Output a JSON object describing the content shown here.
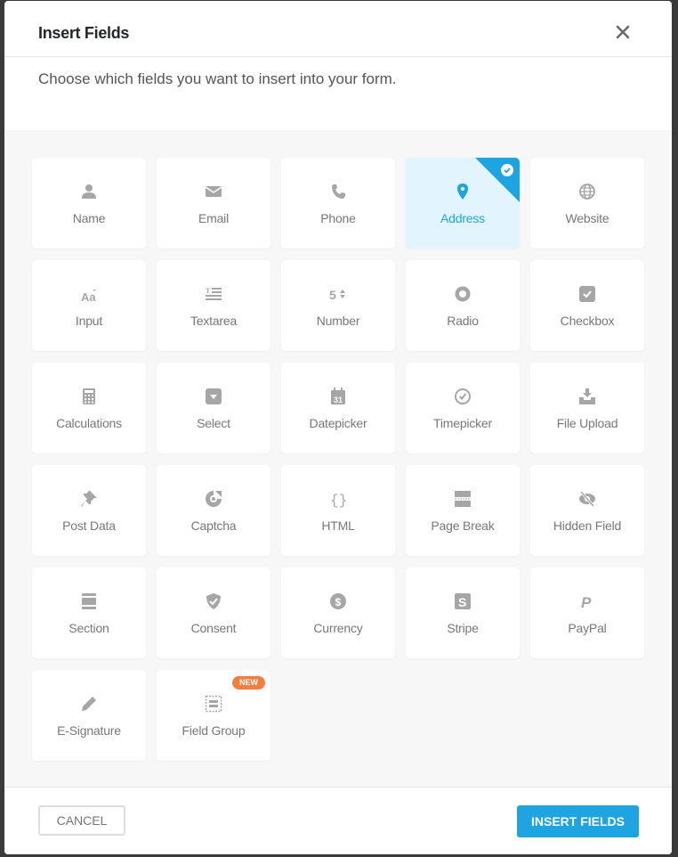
{
  "dialog": {
    "title": "Insert Fields",
    "subtitle": "Choose which fields you want to insert into your form.",
    "close_icon": "close-icon"
  },
  "colors": {
    "accent": "#1ea4e0",
    "selected_bg": "#e2f5fe",
    "badge": "#f47d3f",
    "icon": "#a6a6a6"
  },
  "fields": [
    {
      "label": "Name",
      "icon": "user-icon",
      "selected": false
    },
    {
      "label": "Email",
      "icon": "envelope-icon",
      "selected": false
    },
    {
      "label": "Phone",
      "icon": "phone-icon",
      "selected": false
    },
    {
      "label": "Address",
      "icon": "map-pin-icon",
      "selected": true
    },
    {
      "label": "Website",
      "icon": "globe-icon",
      "selected": false
    },
    {
      "label": "Input",
      "icon": "text-input-icon",
      "selected": false
    },
    {
      "label": "Textarea",
      "icon": "textarea-icon",
      "selected": false
    },
    {
      "label": "Number",
      "icon": "number-icon",
      "selected": false
    },
    {
      "label": "Radio",
      "icon": "radio-icon",
      "selected": false
    },
    {
      "label": "Checkbox",
      "icon": "checkbox-icon",
      "selected": false
    },
    {
      "label": "Calculations",
      "icon": "calculator-icon",
      "selected": false
    },
    {
      "label": "Select",
      "icon": "select-icon",
      "selected": false
    },
    {
      "label": "Datepicker",
      "icon": "calendar-icon",
      "selected": false
    },
    {
      "label": "Timepicker",
      "icon": "clock-icon",
      "selected": false
    },
    {
      "label": "File Upload",
      "icon": "upload-icon",
      "selected": false
    },
    {
      "label": "Post Data",
      "icon": "pin-icon",
      "selected": false
    },
    {
      "label": "Captcha",
      "icon": "captcha-icon",
      "selected": false
    },
    {
      "label": "HTML",
      "icon": "braces-icon",
      "selected": false
    },
    {
      "label": "Page Break",
      "icon": "page-break-icon",
      "selected": false
    },
    {
      "label": "Hidden Field",
      "icon": "eye-slash-icon",
      "selected": false
    },
    {
      "label": "Section",
      "icon": "section-icon",
      "selected": false
    },
    {
      "label": "Consent",
      "icon": "shield-check-icon",
      "selected": false
    },
    {
      "label": "Currency",
      "icon": "dollar-icon",
      "selected": false
    },
    {
      "label": "Stripe",
      "icon": "stripe-icon",
      "selected": false
    },
    {
      "label": "PayPal",
      "icon": "paypal-icon",
      "selected": false
    },
    {
      "label": "E-Signature",
      "icon": "pencil-icon",
      "selected": false
    },
    {
      "label": "Field Group",
      "icon": "field-group-icon",
      "selected": false,
      "badge": "NEW"
    }
  ],
  "footer": {
    "cancel_label": "CANCEL",
    "insert_label": "INSERT FIELDS"
  }
}
